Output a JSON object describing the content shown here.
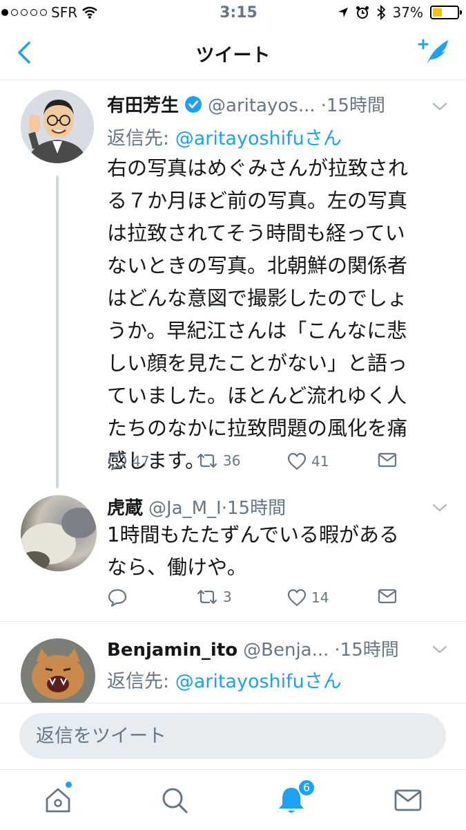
{
  "status_bar": {
    "carrier": "SFR",
    "time": "3:15",
    "battery_percent": "37%",
    "battery_level": 0.37,
    "signal_bars": 1
  },
  "nav": {
    "title": "ツイート",
    "back_icon": "chevron-left-icon",
    "compose_icon": "compose-tweet-icon"
  },
  "tweets": [
    {
      "name": "有田芳生",
      "verified": true,
      "handle": "@aritayos...",
      "time": "·15時間",
      "reply_to_label": "返信先: ",
      "reply_to_handle": "@aritayoshifu",
      "reply_to_suffix": "さん",
      "lines": [
        "右の写真はめぐみさんが拉致され",
        "る７か月ほど前の写真。左の写真",
        "は拉致されてそう時間も経ってい",
        "ないときの写真。北朝鮮の関係者",
        "はどんな意図で撮影したのでしょ",
        "うか。早紀江さんは「こんなに悲",
        "しい顔を見たことがない」と語っ",
        "ていました。ほとんど流れゆく人",
        "たちのなかに拉致問題の風化を痛",
        "感します。"
      ],
      "replies": "47",
      "retweets": "36",
      "likes": "41"
    },
    {
      "name": "虎蔵",
      "handle": "@Ja_M_I",
      "time": "·15時間",
      "lines": [
        "1時間もたたずんでいる暇がある",
        "なら、働けや。"
      ],
      "replies": "",
      "retweets": "3",
      "likes": "14"
    },
    {
      "name": "Benjamin_ito",
      "handle": "@Benja...",
      "time": "·15時間",
      "reply_to_label": "返信先: ",
      "reply_to_handle": "@aritayoshifu",
      "reply_to_suffix": "さん"
    }
  ],
  "reply_bar": {
    "placeholder": "返信をツイート"
  },
  "tabbar": {
    "items": [
      "home-icon",
      "search-icon",
      "notifications-icon",
      "messages-icon"
    ],
    "notification_badge": "6"
  },
  "colors": {
    "accent": "#1da1f2",
    "muted": "#657786",
    "thread_line": "#ccd6dd"
  }
}
